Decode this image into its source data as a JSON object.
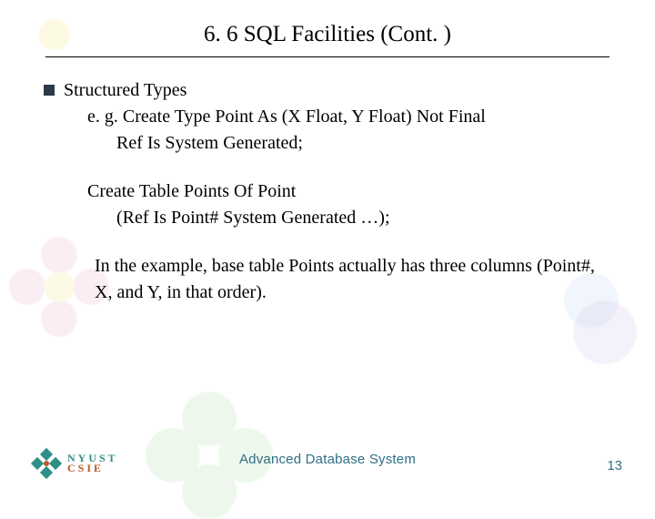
{
  "title": "6. 6    SQL Facilities (Cont. )",
  "bullet": {
    "heading": "Structured Types",
    "line1": "e. g. Create Type Point As (X Float, Y Float) Not Final",
    "line2": "Ref Is System Generated;",
    "line3": "Create Table Points Of Point",
    "line4": "(Ref Is Point# System Generated …);",
    "para": "In the example, base table Points actually has three columns (Point#, X, and Y, in that order)."
  },
  "footer": {
    "center": "Advanced Database System",
    "page": "13"
  },
  "logo": {
    "line1": "NYUST",
    "line2": "CSIE"
  }
}
